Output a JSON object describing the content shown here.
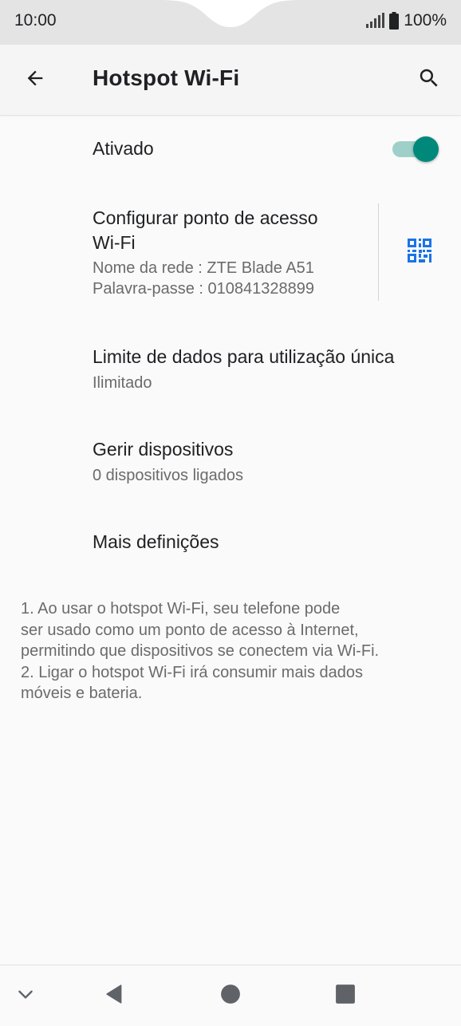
{
  "status_bar": {
    "time": "10:00",
    "battery": "100%",
    "signal_icon": "signal-icon",
    "battery_icon": "battery-icon"
  },
  "app_bar": {
    "title": "Hotspot Wi-Fi",
    "back_icon": "back-arrow-icon",
    "search_icon": "search-icon"
  },
  "toggle_row": {
    "label": "Ativado",
    "state": "on",
    "accent_color": "#00897b"
  },
  "config_row": {
    "title": "Configurar ponto de acesso Wi-Fi",
    "title_line1": "Configurar ponto de acesso",
    "title_line2": "Wi-Fi",
    "network_name": "Nome da rede : ZTE Blade A51",
    "password": "Palavra-passe : 010841328899",
    "qr_icon": "qr-code-icon",
    "qr_color": "#1a73e8"
  },
  "data_limit_row": {
    "title": "Limite de dados para utilização única",
    "subtitle": "Ilimitado"
  },
  "devices_row": {
    "title": "Gerir dispositivos",
    "subtitle": "0 dispositivos ligados"
  },
  "more_row": {
    "title": "Mais definições"
  },
  "footnote": {
    "lines": [
      "1. Ao usar o hotspot Wi-Fi, seu telefone pode",
      "ser usado como um ponto de acesso à Internet,",
      "permitindo que dispositivos se conectem via Wi-Fi.",
      "2. Ligar o hotspot Wi-Fi irá consumir mais dados",
      "móveis e bateria."
    ]
  },
  "nav_bar": {
    "buttons": [
      "chevron-down-icon",
      "back-triangle-icon",
      "home-circle-icon",
      "recents-square-icon"
    ]
  }
}
